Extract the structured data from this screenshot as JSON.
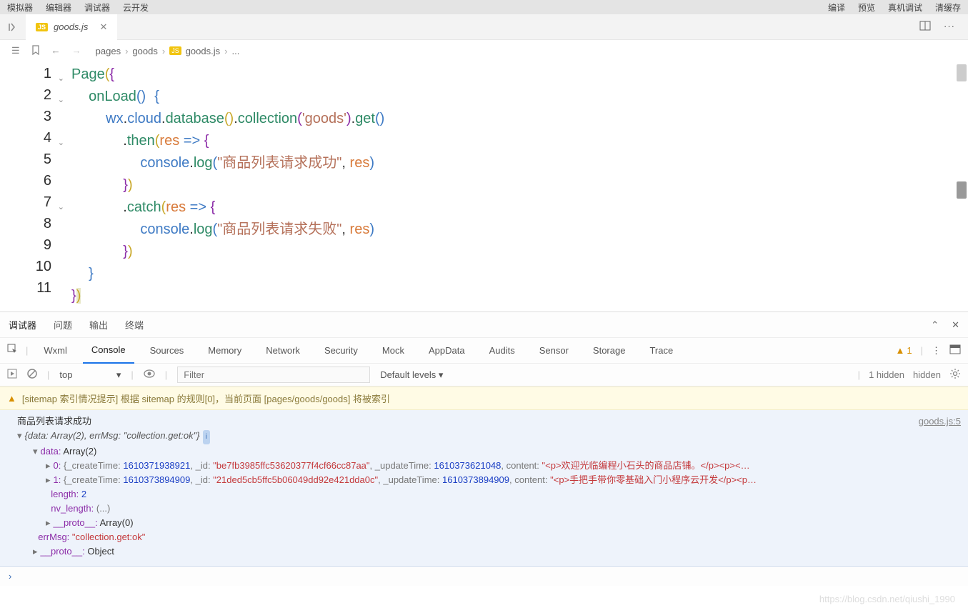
{
  "topMenu": {
    "left": [
      "模拟器",
      "编辑器",
      "调试器",
      "云开发"
    ],
    "right": [
      "编译",
      "预览",
      "真机调试",
      "清缓存"
    ]
  },
  "tab": {
    "badge": "JS",
    "filename": "goods.js"
  },
  "breadcrumb": {
    "parts": [
      "pages",
      "goods",
      "goods.js",
      "..."
    ],
    "jsBadge": "JS"
  },
  "code": {
    "lines": [
      {
        "n": "1",
        "fold": true
      },
      {
        "n": "2",
        "fold": true
      },
      {
        "n": "3"
      },
      {
        "n": "4",
        "fold": true
      },
      {
        "n": "5"
      },
      {
        "n": "6"
      },
      {
        "n": "7",
        "fold": true
      },
      {
        "n": "8"
      },
      {
        "n": "9"
      },
      {
        "n": "10"
      },
      {
        "n": "11"
      }
    ],
    "tokens": {
      "page": "Page",
      "onLoad": "onLoad",
      "wx": "wx",
      "cloud": "cloud",
      "database": "database",
      "collection": "collection",
      "goods": "'goods'",
      "get": "get",
      "then": "then",
      "catch": "catch",
      "res": "res",
      "arrow": " => ",
      "console": "console",
      "log": "log",
      "successStr": "\"商品列表请求成功\"",
      "failStr": "\"商品列表请求失败\""
    }
  },
  "debuggerTabs": [
    "调试器",
    "问题",
    "输出",
    "终端"
  ],
  "devtoolsTabs": [
    "Wxml",
    "Console",
    "Sources",
    "Memory",
    "Network",
    "Security",
    "Mock",
    "AppData",
    "Audits",
    "Sensor",
    "Storage",
    "Trace"
  ],
  "devtoolsRight": {
    "warnCount": "1"
  },
  "consoleToolbar": {
    "context": "top",
    "filterPlaceholder": "Filter",
    "levels": "Default levels",
    "hidden": "1 hidden"
  },
  "sitemap": "[sitemap 索引情况提示] 根据 sitemap 的规则[0]，当前页面 [pages/goods/goods] 将被索引",
  "consoleOut": {
    "successMsg": "商品列表请求成功",
    "source": "goods.js:5",
    "summary_prefix": "{data: Array(2), errMsg: ",
    "summary_errmsg": "\"collection.get:ok\"",
    "summary_suffix": "}",
    "dataLabel": "data:",
    "dataType": "Array(2)",
    "rows": [
      {
        "idx": "0:",
        "createLabel": "_createTime:",
        "createVal": "1610371938921",
        "idLabel": "_id:",
        "idVal": "\"be7fb3985ffc53620377f4cf66cc87aa\"",
        "updateLabel": "_updateTime:",
        "updateVal": "1610373621048",
        "contentLabel": "content:",
        "contentVal": "\"<p>欢迎光临编程小石头的商品店铺。</p><p><…"
      },
      {
        "idx": "1:",
        "createLabel": "_createTime:",
        "createVal": "1610373894909",
        "idLabel": "_id:",
        "idVal": "\"21ded5cb5ffc5b06049dd92e421dda0c\"",
        "updateLabel": "_updateTime:",
        "updateVal": "1610373894909",
        "contentLabel": "content:",
        "contentVal": "\"<p>手把手带你零基础入门小程序云开发</p><p…"
      }
    ],
    "lengthLabel": "length:",
    "lengthVal": "2",
    "nvLengthLabel": "nv_length:",
    "nvLengthVal": "(...)",
    "protoLabel": "__proto__:",
    "protoArr": "Array(0)",
    "errMsgLabel": "errMsg:",
    "errMsgVal": "\"collection.get:ok\"",
    "protoObj": "Object"
  },
  "watermark": "https://blog.csdn.net/qiushi_1990"
}
